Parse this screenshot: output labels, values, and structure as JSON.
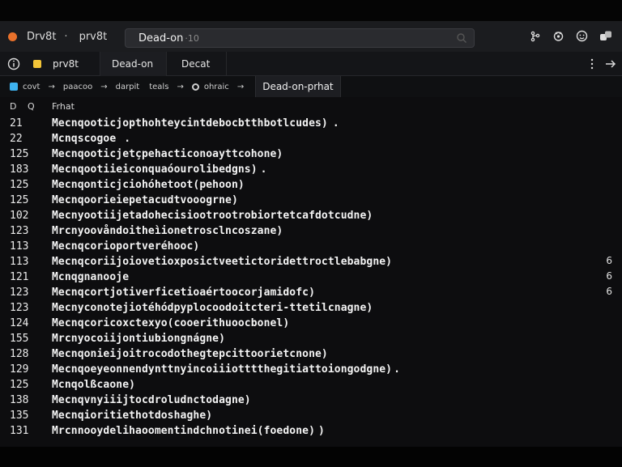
{
  "titlebar": {
    "app_name": "Drv8t",
    "separator": "·",
    "branch": "prv8t",
    "search_value": "Dead-on",
    "search_hint": "·10"
  },
  "tabs": [
    {
      "label": "prv8t"
    },
    {
      "label": "Dead-on"
    },
    {
      "label": "Decat"
    }
  ],
  "breadcrumb": {
    "items": [
      "covt",
      "paacoo",
      "darpit",
      "teals",
      "ohraic"
    ],
    "separator": "→",
    "active": "Dead-on-prhat"
  },
  "columns": {
    "c1": "D",
    "c2": "Q",
    "c3": "Frhat"
  },
  "rows": [
    {
      "num": "21",
      "text": "Mecnqooticjopthohteycintdebocbtthbotlcudes)",
      "trail": ".",
      "badge": ""
    },
    {
      "num": "22",
      "text": "Mcnqscogoe",
      "trail": ".",
      "badge": ""
    },
    {
      "num": "125",
      "text": "Mecnqooticjetçpehacticonoayttcohone)",
      "trail": "",
      "badge": ""
    },
    {
      "num": "183",
      "text": "Mecnqootiieiconquaóourolibedgns)",
      "trail": ".",
      "badge": ""
    },
    {
      "num": "125",
      "text": "Mecnqonticjciohóhetoot(pehoon)",
      "trail": "",
      "badge": ""
    },
    {
      "num": "125",
      "text": "Mecnqoorieiepetacudtvooogrne)",
      "trail": "",
      "badge": ""
    },
    {
      "num": "102",
      "text": "Mecnyootiijetadohecisiootrootrobiortetcafdotcudne)",
      "trail": "",
      "badge": ""
    },
    {
      "num": "123",
      "text": "Mrcnyoovåndoitheìionetrosclncoszane)",
      "trail": "",
      "badge": ""
    },
    {
      "num": "113",
      "text": "Mecnqcorioportveréhooc)",
      "trail": "",
      "badge": ""
    },
    {
      "num": "113",
      "text": "Mecnqcoriijoiovetioxposictveetictoridettroctlebabgne)",
      "trail": "",
      "badge": "6"
    },
    {
      "num": "121",
      "text": "Mcnqgnanooje",
      "trail": "",
      "badge": "6"
    },
    {
      "num": "123",
      "text": "Mecnqcortjotiverficetioaértoocorjamidofc)",
      "trail": "",
      "badge": "6"
    },
    {
      "num": "123",
      "text": "Mecnyconotejiotéhódpyplocoodoitcteri-ttetilcnagne)",
      "trail": "",
      "badge": ""
    },
    {
      "num": "124",
      "text": "Mecnqcoricoxctexyo(cooerithuoocbonel)",
      "trail": "",
      "badge": ""
    },
    {
      "num": "155",
      "text": "Mrcnyocoiijontiubiongnágne)",
      "trail": "",
      "badge": ""
    },
    {
      "num": "128",
      "text": "Mecnqonieijoitrocodothegtepcittoorietcnone)",
      "trail": "",
      "badge": ""
    },
    {
      "num": "129",
      "text": "Mecnqoeyeonnendynttnyincoiiiotttthegitiattoiongodgne)",
      "trail": ".",
      "badge": ""
    },
    {
      "num": "125",
      "text": "Mcnqolßcaone)",
      "trail": "",
      "badge": ""
    },
    {
      "num": "138",
      "text": "Mecnqvnyiiijtocdroludnctodagne)",
      "trail": "",
      "badge": ""
    },
    {
      "num": "135",
      "text": "Mecnqioritiethotdoshaghe)",
      "trail": "",
      "badge": ""
    },
    {
      "num": "131",
      "text": "Mrcnnooydelihaoomentindchnotinei(foedone)",
      "trail": ")",
      "badge": ""
    }
  ],
  "colors": {
    "app_icon": "#e8712b",
    "folder": "#f2c438",
    "crumb_square": "#3eb3f0",
    "background": "#0d0d0f"
  }
}
